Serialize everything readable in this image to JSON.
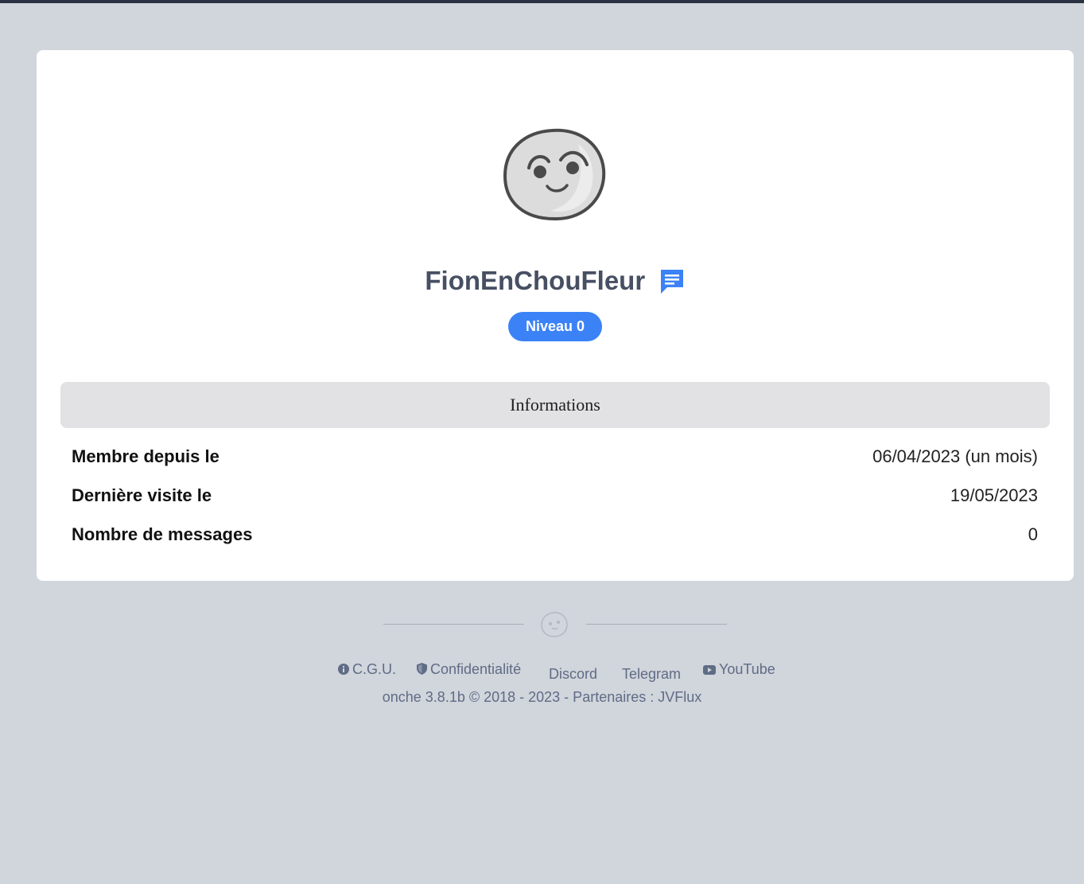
{
  "profile": {
    "username": "FionEnChouFleur",
    "level_label": "Niveau 0"
  },
  "info": {
    "title": "Informations",
    "rows": [
      {
        "label": "Membre depuis le",
        "value": "06/04/2023 (un mois)"
      },
      {
        "label": "Dernière visite le",
        "value": "19/05/2023"
      },
      {
        "label": "Nombre de messages",
        "value": "0"
      }
    ]
  },
  "footer": {
    "links": {
      "cgu": "C.G.U.",
      "privacy": "Confidentialité",
      "discord": "Discord",
      "telegram": "Telegram",
      "youtube": "YouTube"
    },
    "copyright_prefix": "onche 3.8.1b © 2018 - 2023 - Partenaires : ",
    "partner": "JVFlux"
  },
  "colors": {
    "background": "#d1d5dc",
    "card": "#ffffff",
    "accent": "#3b82f6",
    "username": "#474f63",
    "footer_text": "#5f6c85"
  },
  "icons": {
    "avatar": "onche-smiley-avatar",
    "message": "message-icon",
    "cgu": "info-icon",
    "privacy": "shield-icon",
    "youtube": "youtube-icon",
    "footer_logo": "onche-smiley-icon"
  }
}
